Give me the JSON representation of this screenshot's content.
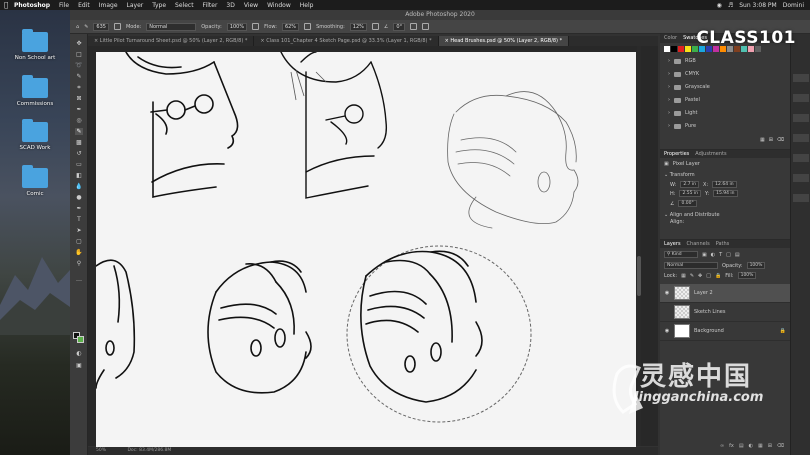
{
  "menubar": {
    "app_name": "Photoshop",
    "items": [
      "File",
      "Edit",
      "Image",
      "Layer",
      "Type",
      "Select",
      "Filter",
      "3D",
      "View",
      "Window",
      "Help"
    ],
    "clock": "Sun 3:08 PM",
    "user": "Domini"
  },
  "desktop": {
    "folders": [
      "Non School art",
      "Commissions",
      "SCAD Work",
      "Comic"
    ]
  },
  "window_title": "Adobe Photoshop 2020",
  "options_bar": {
    "mode_label": "Mode:",
    "mode_value": "Normal",
    "opacity_label": "Opacity:",
    "opacity_value": "100%",
    "flow_label": "Flow:",
    "flow_value": "62%",
    "smoothing_label": "Smoothing:",
    "smoothing_value": "12%",
    "angle_value": "0°",
    "brush_size": "635"
  },
  "tabs": [
    "Little Pilot Turnaround Sheet.psd @ 50% (Layer 2, RGB/8) *",
    "Class 101_Chapter 4 Sketch Page.psd @ 33.3% (Layer 1, RGB/8) *",
    "Head Brushes.psd @ 50% (Layer 2, RGB/8) *"
  ],
  "active_tab_index": 2,
  "status_bar": {
    "zoom": "50%",
    "doc": "Doc: 83.4M/286.8M"
  },
  "brand": "CLASS101",
  "watermark": {
    "cn": "灵感中国",
    "url": "lingganchina.com"
  },
  "panels": {
    "color_tabs": [
      "Color",
      "Swatches"
    ],
    "active_color_tab": "Swatches",
    "swatch_colors": [
      "#ffffff",
      "#000000",
      "#e02020",
      "#f7e01a",
      "#3cb04a",
      "#1aa7e0",
      "#2a3fb0",
      "#c030a0",
      "#ff8c00",
      "#8c8c8c",
      "#804020",
      "#50c0b0",
      "#f0a0b0",
      "#606060"
    ],
    "swatch_groups": [
      "RGB",
      "CMYK",
      "Grayscale",
      "Pastel",
      "Light",
      "Pure"
    ],
    "properties_tabs": [
      "Properties",
      "Adjustments"
    ],
    "active_properties_tab": "Properties",
    "pixel_layer_label": "Pixel Layer",
    "transform_label": "Transform",
    "w_value": "2.7 in",
    "x_value": "12.64 in",
    "h_value": "2.55 in",
    "y_value": "15.94 in",
    "angle_value": "0.00°",
    "align_label": "Align and Distribute",
    "align_sub": "Align:",
    "layers_tabs": [
      "Layers",
      "Channels",
      "Paths"
    ],
    "active_layers_tab": "Layers",
    "kind_label": "Kind",
    "blend_mode": "Normal",
    "opacity_label": "Opacity:",
    "opacity_value": "100%",
    "lock_label": "Lock:",
    "fill_label": "Fill:",
    "fill_value": "100%",
    "layers": [
      {
        "name": "Layer 2",
        "selected": true
      },
      {
        "name": "Sketch Lines",
        "selected": false
      },
      {
        "name": "Background",
        "selected": false
      }
    ]
  }
}
